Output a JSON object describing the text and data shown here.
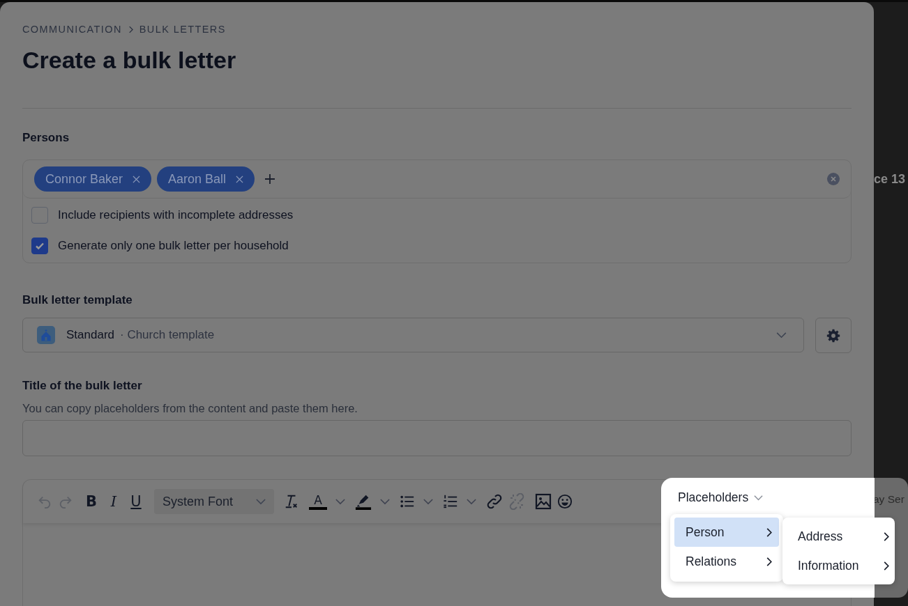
{
  "breadcrumb": [
    "COMMUNICATION",
    "BULK LETTERS"
  ],
  "title": "Create a bulk letter",
  "persons": {
    "label": "Persons",
    "chips": [
      {
        "name": "Connor Baker"
      },
      {
        "name": "Aaron Ball"
      }
    ],
    "options": [
      {
        "label": "Include recipients with incomplete addresses",
        "checked": false
      },
      {
        "label": "Generate only one bulk letter per household",
        "checked": true
      }
    ]
  },
  "template": {
    "label": "Bulk letter template",
    "name": "Standard",
    "description": "· Church template"
  },
  "title_field": {
    "label": "Title of the bulk letter",
    "hint": "You can copy placeholders from the content and paste them here."
  },
  "editor": {
    "toolbar": [
      [
        {
          "kind": "undo",
          "disabled": true
        },
        {
          "kind": "redo",
          "disabled": true
        }
      ],
      [
        {
          "kind": "bold",
          "label": "B",
          "disabled": false
        },
        {
          "kind": "italic",
          "label": "I",
          "disabled": false
        },
        {
          "kind": "underline",
          "label": "U",
          "disabled": false
        }
      ],
      [
        {
          "kind": "font",
          "label": "System Font",
          "disabled": false
        }
      ],
      [
        {
          "kind": "clear-format",
          "disabled": false
        }
      ],
      [
        {
          "kind": "text-color",
          "label": "A",
          "disabled": false
        },
        {
          "kind": "caret",
          "disabled": false
        }
      ],
      [
        {
          "kind": "highlight",
          "disabled": false
        },
        {
          "kind": "caret",
          "disabled": false
        }
      ],
      [
        {
          "kind": "bullet-list",
          "disabled": false
        },
        {
          "kind": "caret",
          "disabled": false
        }
      ],
      [
        {
          "kind": "numbered-list",
          "disabled": false
        },
        {
          "kind": "caret",
          "disabled": false
        }
      ],
      [
        {
          "kind": "link",
          "disabled": false
        },
        {
          "kind": "unlink",
          "disabled": true
        }
      ],
      [
        {
          "kind": "image",
          "disabled": false
        },
        {
          "kind": "emoji",
          "disabled": false
        }
      ]
    ],
    "placeholders": {
      "label": "Placeholders",
      "menu": [
        {
          "label": "Person",
          "selected": true
        },
        {
          "label": "Relations",
          "selected": false
        }
      ],
      "submenu": [
        {
          "label": "Address"
        },
        {
          "label": "Information"
        }
      ]
    }
  },
  "background_texts": [
    "ce 13",
    "ay Ser"
  ]
}
